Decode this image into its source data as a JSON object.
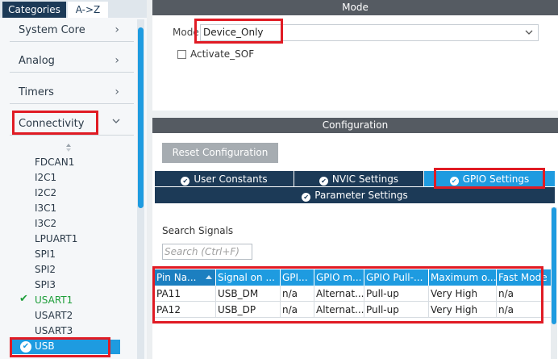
{
  "sidebar": {
    "tabs": [
      "Categories",
      "A->Z"
    ],
    "categories": [
      {
        "label": "System Core",
        "chevron": ">"
      },
      {
        "label": "Analog",
        "chevron": ">"
      },
      {
        "label": "Timers",
        "chevron": ">"
      },
      {
        "label": "Connectivity",
        "chevron": "v"
      }
    ],
    "peripherals": [
      "FDCAN1",
      "I2C1",
      "I2C2",
      "I3C1",
      "I3C2",
      "LPUART1",
      "SPI1",
      "SPI2",
      "SPI3",
      "USART1",
      "USART2",
      "USART3",
      "USB"
    ],
    "checked_peripherals": [
      "USART1",
      "USB"
    ],
    "selected": "USB"
  },
  "mode": {
    "header": "Mode",
    "label": "Mode",
    "value": "Device_Only",
    "activate_sof_label": "Activate_SOF",
    "activate_sof_checked": false
  },
  "configuration": {
    "header": "Configuration",
    "reset_button": "Reset Configuration",
    "tabs": [
      {
        "label": "User Constants",
        "active": false
      },
      {
        "label": "NVIC Settings",
        "active": false
      },
      {
        "label": "GPIO Settings",
        "active": true
      },
      {
        "label": "Parameter Settings",
        "active": false
      }
    ],
    "search_title": "Search Signals",
    "search_placeholder": "Search (Ctrl+F)",
    "table": {
      "columns": [
        "Pin Na...",
        "Signal on ...",
        "GPI...",
        "GPIO m...",
        "GPIO Pull-...",
        "Maximum o...",
        "Fast Mode"
      ],
      "rows": [
        [
          "PA11",
          "USB_DM",
          "n/a",
          "Alternat...",
          "Pull-up",
          "Very High",
          "n/a"
        ],
        [
          "PA12",
          "USB_DP",
          "n/a",
          "Alternat...",
          "Pull-up",
          "Very High",
          "n/a"
        ]
      ]
    }
  },
  "colors": {
    "accent": "#1e9be0",
    "dark_navy": "#1c3a57",
    "header_gray": "#555b62",
    "highlight_red": "#e01b24",
    "ok_green": "#1e9e3a"
  }
}
